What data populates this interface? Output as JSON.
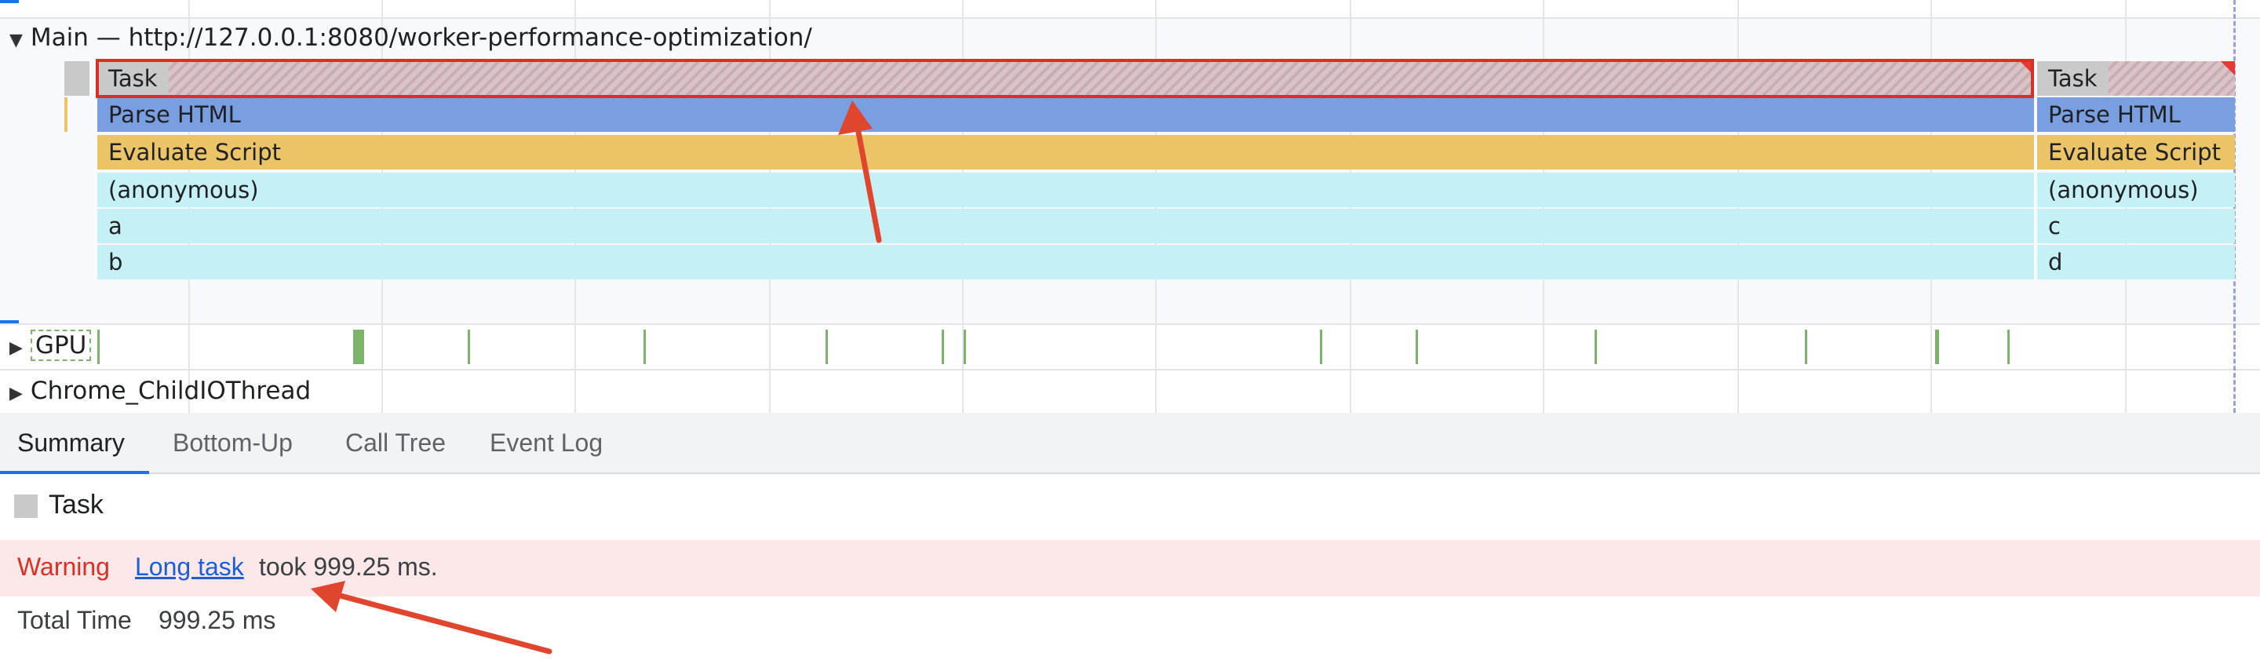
{
  "timeline": {
    "main_track_title": "Main — http://127.0.0.1:8080/worker-performance-optimization/",
    "gpu_track_title": "GPU",
    "io_track_title": "Chrome_ChildIOThread",
    "flame_left": {
      "task": "Task",
      "parse_html": "Parse HTML",
      "evaluate_script": "Evaluate Script",
      "anonymous": "(anonymous)",
      "fn1": "a",
      "fn2": "b"
    },
    "flame_right": {
      "task": "Task",
      "parse_html": "Parse HTML",
      "evaluate_script": "Evaluate Script",
      "anonymous": "(anonymous)",
      "fn1": "c",
      "fn2": "d"
    }
  },
  "tabs": [
    {
      "label": "Summary",
      "active": true
    },
    {
      "label": "Bottom-Up",
      "active": false
    },
    {
      "label": "Call Tree",
      "active": false
    },
    {
      "label": "Event Log",
      "active": false
    }
  ],
  "summary": {
    "title": "Task",
    "warning_label": "Warning",
    "warning_link": "Long task",
    "warning_text": "took 999.25 ms.",
    "total_time_label": "Total Time",
    "total_time_value": "999.25 ms"
  },
  "colors": {
    "task": "#c9c9c9",
    "parse_html": "#7a9fe0",
    "evaluate_script": "#ebc468",
    "js_function": "#c5f0f5",
    "gpu": "#7cb46a",
    "warning": "#d93025",
    "highlight": "#d93025",
    "annotation_arrow": "#e0452e",
    "tab_accent": "#1a73e8"
  }
}
